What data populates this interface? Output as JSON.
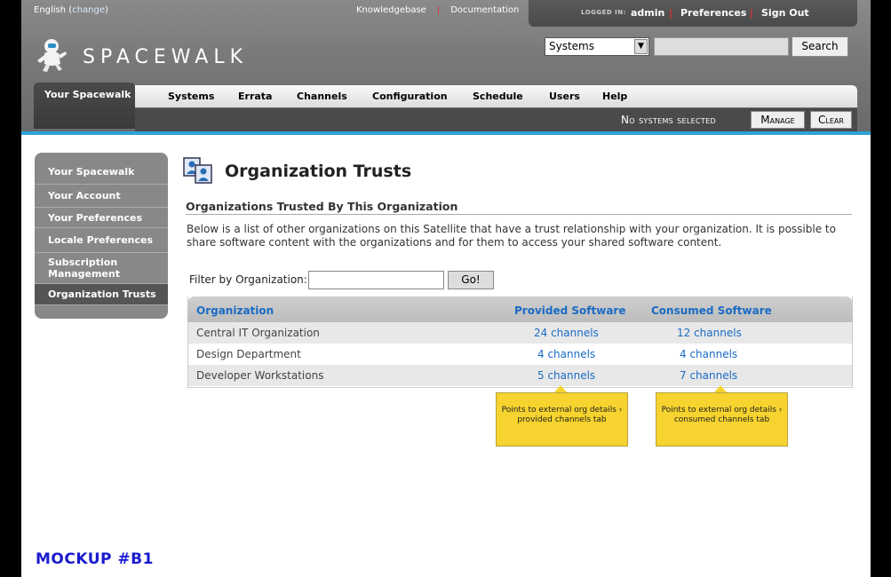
{
  "header": {
    "language": "English",
    "language_change": "change",
    "links": [
      "Knowledgebase",
      "Documentation"
    ],
    "logged_in_label": "LOGGED IN:",
    "username": "admin",
    "preferences": "Preferences",
    "sign_out": "Sign Out",
    "brand": "SPACEWALK",
    "search_select_value": "Systems",
    "search_input_value": "",
    "search_button": "Search"
  },
  "nav": {
    "active_tab": "Your Spacewalk",
    "items": [
      "Systems",
      "Errata",
      "Channels",
      "Configuration",
      "Schedule",
      "Users",
      "Help"
    ]
  },
  "subbar": {
    "status": "No systems selected",
    "manage": "Manage",
    "clear": "Clear"
  },
  "sidebar": {
    "items": [
      {
        "label": "Your Spacewalk"
      },
      {
        "label": "Your Account"
      },
      {
        "label": "Your Preferences"
      },
      {
        "label": "Locale Preferences"
      },
      {
        "label": "Subscription\nManagement"
      },
      {
        "label": "Organization Trusts"
      }
    ]
  },
  "main": {
    "title": "Organization Trusts",
    "section_title": "Organizations Trusted By This Organization",
    "description": "Below is a list of other organizations on this Satellite that have a trust relationship with your organization. It is possible to share software content with the organizations and for them to access your shared software content.",
    "filter_label": "Filter by Organization:",
    "filter_value": "",
    "go_button": "Go!"
  },
  "table": {
    "columns": [
      "Organization",
      "Provided Software",
      "Consumed Software"
    ],
    "rows": [
      {
        "org": "Central IT Organization",
        "provided": "24 channels",
        "consumed": "12 channels"
      },
      {
        "org": "Design Department",
        "provided": "4 channels",
        "consumed": "4 channels"
      },
      {
        "org": "Developer Workstations",
        "provided": "5 channels",
        "consumed": "7 channels"
      }
    ]
  },
  "notes": {
    "provided": "Points to external org details › provided channels tab",
    "consumed": "Points to external org details › consumed channels tab"
  },
  "mockup_label": "MOCKUP #B1",
  "colors": {
    "accent_blue": "#2ea3d6",
    "link_blue": "#1a6bc4",
    "note_yellow": "#f6d32e",
    "separator_red": "#e03030"
  }
}
